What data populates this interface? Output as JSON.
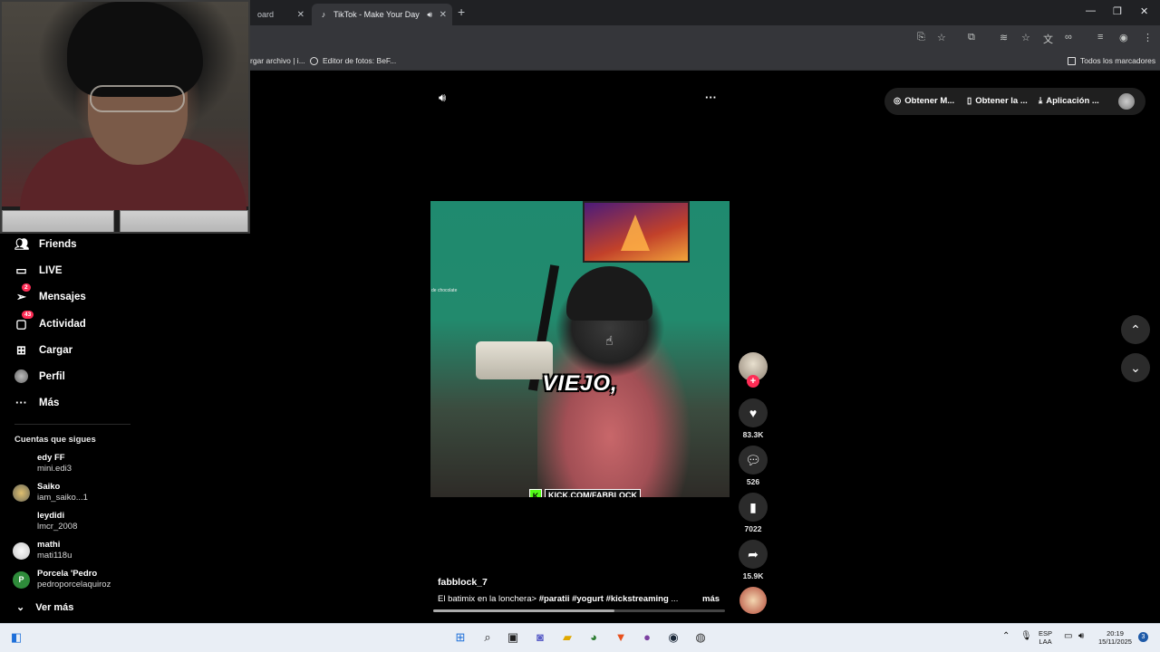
{
  "browser": {
    "tabs": [
      {
        "label": "oard",
        "active": false
      },
      {
        "label": "TikTok - Make Your Day",
        "active": true
      }
    ],
    "bookmarks": [
      {
        "label": "rgar archivo | i..."
      },
      {
        "label": "Editor de fotos: BeF..."
      },
      {
        "label": "Todos los marcadores"
      }
    ]
  },
  "sidebar": {
    "items": [
      {
        "label": "Friends",
        "icon": "friends-icon"
      },
      {
        "label": "LIVE",
        "icon": "live-icon"
      },
      {
        "label": "Mensajes",
        "icon": "messages-icon",
        "badge": "2"
      },
      {
        "label": "Actividad",
        "icon": "activity-icon",
        "badge": "43"
      },
      {
        "label": "Cargar",
        "icon": "upload-icon"
      },
      {
        "label": "Perfil",
        "icon": "profile-avatar"
      },
      {
        "label": "Más",
        "icon": "more-icon"
      }
    ],
    "following_title": "Cuentas que sigues",
    "following": [
      {
        "name": "edy FF",
        "handle": "mini.edi3"
      },
      {
        "name": "Saiko",
        "handle": "iam_saiko...1"
      },
      {
        "name": "leydidi",
        "handle": "lmcr_2008"
      },
      {
        "name": "mathi",
        "handle": "mati118u"
      },
      {
        "name": "Porcela 'Pedro",
        "handle": "pedroporcelaquiroz",
        "initial": "P"
      }
    ],
    "see_more": "Ver más"
  },
  "topbar": {
    "get_coins": "Obtener M...",
    "get_app": "Obtener la ...",
    "download_app": "Aplicación ..."
  },
  "video": {
    "caption_overlay": "VIEJO,",
    "small_text": "de chocolate",
    "kick_badge": "KICK.COM/FABBLOCK",
    "kick_logo": "K",
    "author": "fabblock_7",
    "description_text": "El batimix en la lonchera> ",
    "hashtags": "#paratii #yogurt #kickstreaming",
    "description_ellipsis": " ...",
    "more_label": "más",
    "progress": 0.62
  },
  "actions": {
    "likes": "83.3K",
    "comments": "526",
    "saves": "7022",
    "shares": "15.9K"
  },
  "taskbar": {
    "lang_line1": "ESP",
    "lang_line2": "LAA",
    "time": "20:19",
    "date": "15/11/2025",
    "notifications": "3"
  },
  "colors": {
    "tiktok_red": "#fe2c55",
    "kick_green": "#53fc18"
  }
}
